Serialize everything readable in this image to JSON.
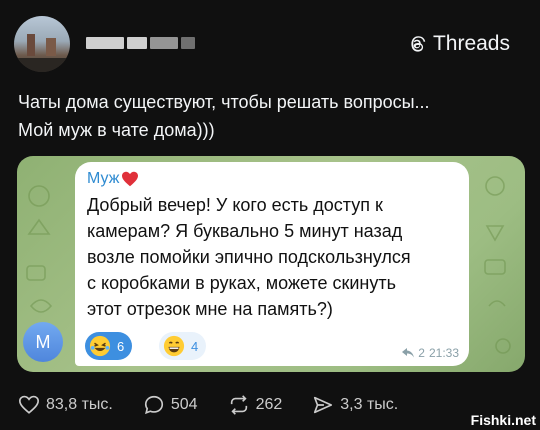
{
  "post": {
    "author_avatar": "avatar-image",
    "brand_label": "Threads",
    "text_lines": [
      "Чаты дома существуют, чтобы решать вопросы...",
      "Мой муж в чате дома)))"
    ]
  },
  "chat": {
    "sender_avatar_letter": "M",
    "sender_name": "Муж",
    "message_lines": [
      "Добрый вечер! У кого есть доступ к",
      "камерам? Я буквально 5 минут назад",
      "возле помойки эпично подскользнулся",
      "с коробками в руках, можете скинуть",
      "этот отрезок мне на память?)"
    ],
    "reactions": [
      {
        "emoji": "rolling-on-floor-laughing",
        "count": "6"
      },
      {
        "emoji": "grinning-face",
        "count": "4"
      }
    ],
    "replies": "2",
    "time": "21:33"
  },
  "actions": {
    "likes": "83,8 тыс.",
    "comments": "504",
    "reposts": "262",
    "shares": "3,3 тыс."
  },
  "watermark": "Fishki.net",
  "colors": {
    "background": "#101010",
    "chat_background": "#9dbd83",
    "accent_blue": "#3d8fe0"
  }
}
